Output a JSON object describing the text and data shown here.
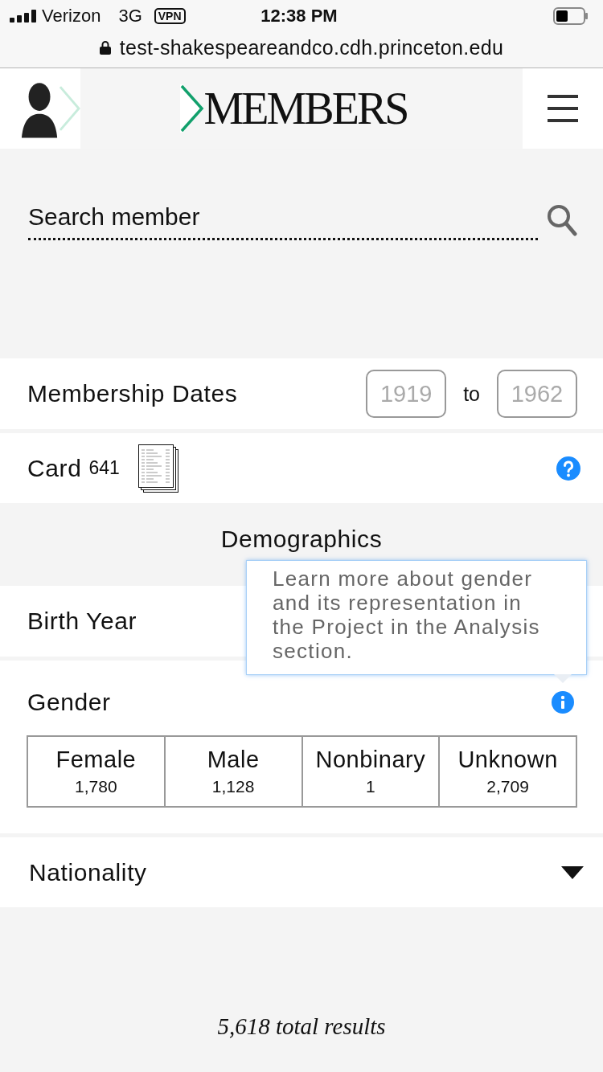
{
  "status_bar": {
    "carrier": "Verizon",
    "network": "3G",
    "vpn": "VPN",
    "time": "12:38 PM"
  },
  "address_bar": {
    "url": "test-shakespeareandco.cdh.princeton.edu"
  },
  "header": {
    "title": "MEMBERS"
  },
  "search": {
    "placeholder": "Search member"
  },
  "membership_dates": {
    "label": "Membership Dates",
    "start": {
      "placeholder": "1919"
    },
    "separator": "to",
    "end": {
      "placeholder": "1962"
    }
  },
  "card": {
    "label": "Card",
    "count": "641"
  },
  "demographics": {
    "heading": "Demographics",
    "birth_year": {
      "label": "Birth Year"
    },
    "gender": {
      "label": "Gender",
      "tooltip": "Learn more about gender and its representation in the Project in the Analysis section.",
      "options": [
        {
          "label": "Female",
          "count": "1,780",
          "selected": false
        },
        {
          "label": "Male",
          "count": "1,128",
          "selected": false
        },
        {
          "label": "Nonbinary",
          "count": "1",
          "selected": false
        },
        {
          "label": "Unknown",
          "count": "2,709",
          "selected": false
        }
      ]
    },
    "nationality": {
      "label": "Nationality",
      "expanded": false
    }
  },
  "results": {
    "total": "5,618 total results"
  }
}
